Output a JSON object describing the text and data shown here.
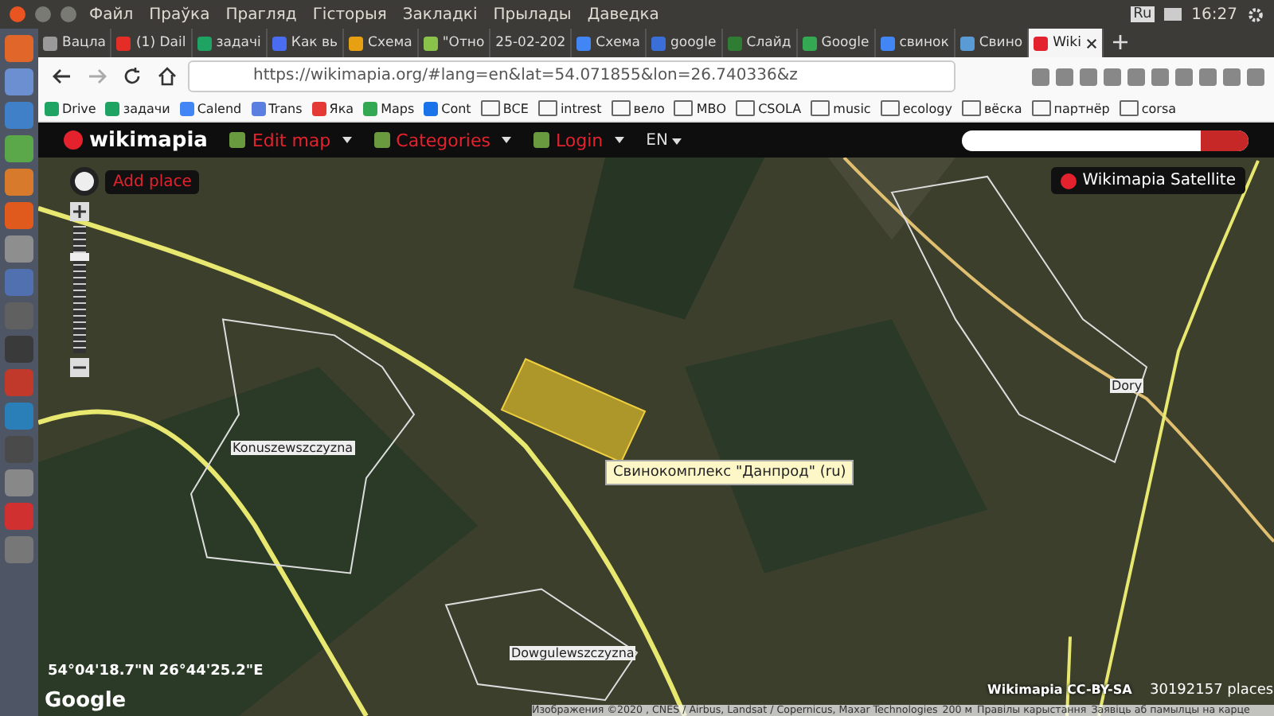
{
  "system_menu": {
    "items": [
      "Файл",
      "Праўка",
      "Прагляд",
      "Гісторыя",
      "Закладкі",
      "Прылады",
      "Даведка"
    ],
    "keyboard": "Ru",
    "clock": "16:27"
  },
  "tabs": [
    {
      "label": "Вацла",
      "color": "#9a9a9a",
      "selected": false
    },
    {
      "label": "(1) Dail",
      "color": "#e52d27",
      "selected": false
    },
    {
      "label": "задачі",
      "color": "#1ea362",
      "selected": false
    },
    {
      "label": "Как вь",
      "color": "#4a6cf0",
      "selected": false
    },
    {
      "label": "Схема",
      "color": "#e8a013",
      "selected": false
    },
    {
      "label": "\"Отно",
      "color": "#8bc34a",
      "selected": false
    },
    {
      "label": "25-02-202",
      "selected": false
    },
    {
      "label": "Схема",
      "color": "#4285f4",
      "selected": false
    },
    {
      "label": "google",
      "color": "#3b6fd8",
      "selected": false
    },
    {
      "label": "Слайд",
      "color": "#2e7d32",
      "selected": false
    },
    {
      "label": "Google",
      "color": "#34a853",
      "selected": false
    },
    {
      "label": "свинок",
      "color": "#4285f4",
      "selected": false
    },
    {
      "label": "Свино",
      "color": "#5b9bd5",
      "selected": false
    },
    {
      "label": "Wiki",
      "color": "#e4222e",
      "selected": true
    }
  ],
  "address_bar": {
    "url": "https://wikimapia.org/#lang=en&lat=54.071855&lon=26.740336&z"
  },
  "bookmarks": [
    {
      "label": "Drive",
      "kind": "site",
      "color": "#1fa463"
    },
    {
      "label": "задачи",
      "kind": "site",
      "color": "#1ea362"
    },
    {
      "label": "Calend",
      "kind": "site",
      "color": "#4285f4"
    },
    {
      "label": "Trans",
      "kind": "site",
      "color": "#5b7fe0"
    },
    {
      "label": "Яка",
      "kind": "site",
      "color": "#e53935"
    },
    {
      "label": "Maps",
      "kind": "site",
      "color": "#34a853"
    },
    {
      "label": "Cont",
      "kind": "site",
      "color": "#1a73e8"
    },
    {
      "label": "ВСЕ",
      "kind": "folder"
    },
    {
      "label": "intrest",
      "kind": "folder"
    },
    {
      "label": "вело",
      "kind": "folder"
    },
    {
      "label": "МВО",
      "kind": "folder"
    },
    {
      "label": "CSOLA",
      "kind": "folder"
    },
    {
      "label": "music",
      "kind": "folder"
    },
    {
      "label": "ecology",
      "kind": "folder"
    },
    {
      "label": "вёска",
      "kind": "folder"
    },
    {
      "label": "партнёр",
      "kind": "folder"
    },
    {
      "label": "corsa",
      "kind": "folder"
    }
  ],
  "site_header": {
    "logo": "wikimapia",
    "menus": [
      "Edit map",
      "Categories",
      "Login"
    ],
    "language": "EN"
  },
  "map": {
    "add_place": "Add place",
    "layer": "Wikimapia Satellite",
    "zoom": {
      "level": 0.72
    },
    "labels": [
      "Konuszewszczyzna",
      "Dowgulewszczyzna",
      "Dory"
    ],
    "tooltip": "Свинокомплекс \"Данпрод\" (ru)",
    "coordinates": "54°04'18.7\"N 26°44'25.2\"E",
    "google": "Google",
    "license": "Wikimapia CC-BY-SA",
    "places": "30192157 places",
    "attribution": [
      "Изображения ©2020 , CNES / Airbus, Landsat / Copernicus, Maxar Technologies",
      "200 м",
      "Правілы карыстання",
      "Заявіць аб памылцы на карце"
    ]
  }
}
